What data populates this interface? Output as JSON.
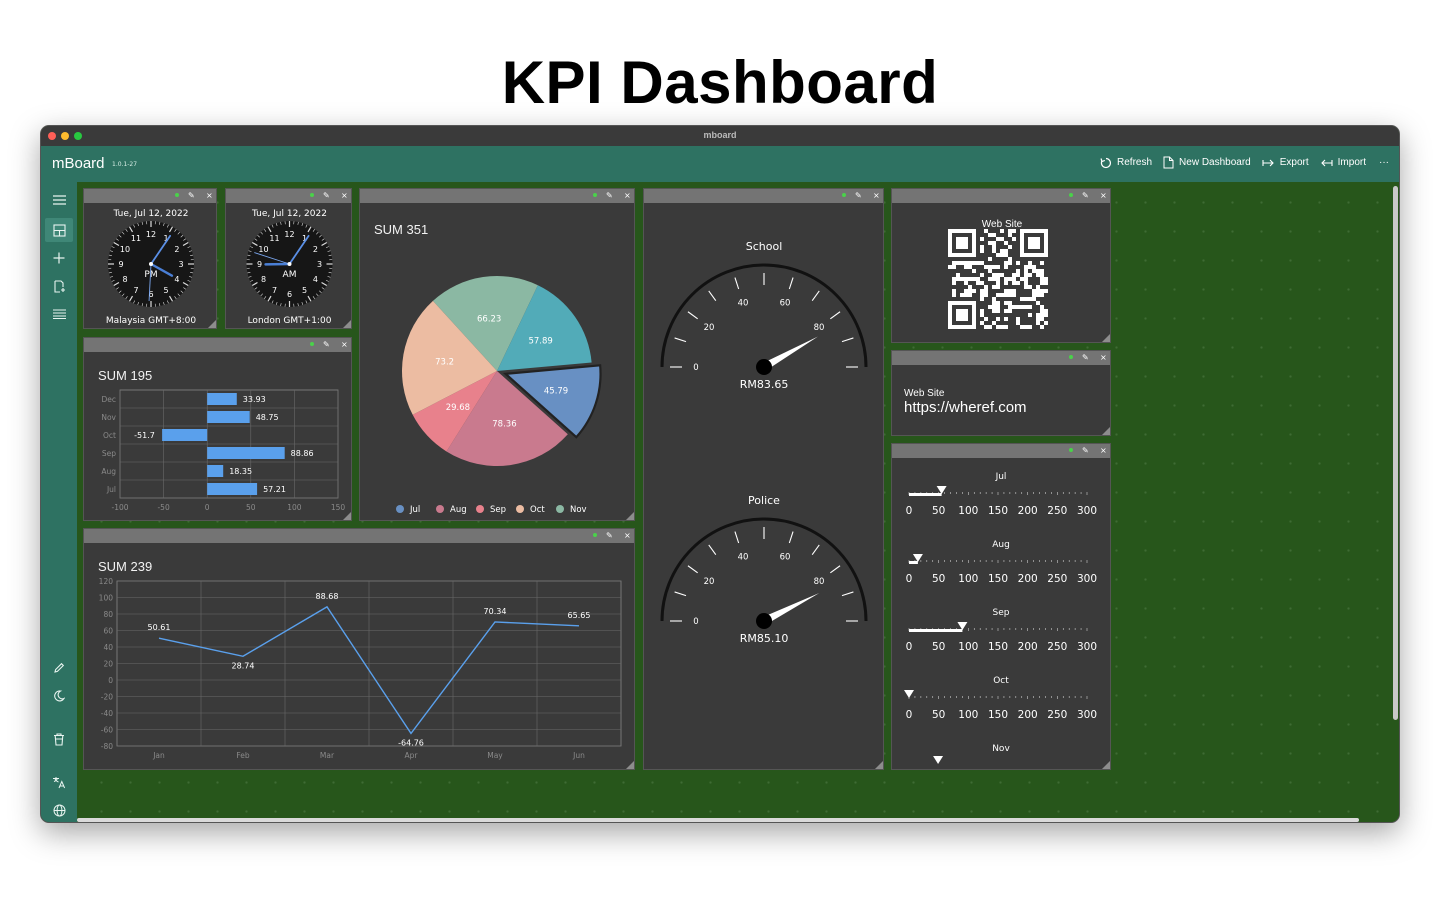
{
  "page": {
    "title": "KPI Dashboard"
  },
  "window": {
    "title": "mboard"
  },
  "app": {
    "brand": "mBoard",
    "version": "1.0.1-27"
  },
  "toolbar": {
    "refresh": "Refresh",
    "new_dashboard": "New Dashboard",
    "export": "Export",
    "import": "Import",
    "more": "···"
  },
  "icons": {
    "menu": "hamburger-icon",
    "dashboard": "dashboard-grid-icon",
    "add": "plus-icon",
    "add_datasource": "add-datasource-icon",
    "list": "list-icon",
    "edit": "pencil-icon",
    "theme": "moon-icon",
    "trash": "trash-icon",
    "translate": "translate-icon",
    "globe": "globe-icon",
    "widget_edit": "pin-icon",
    "widget_close": "close-icon"
  },
  "colors": {
    "accent": "#2e7262",
    "canvas": "#27561b",
    "widget_bg": "#3a3a3a",
    "widget_header": "#747474",
    "bar": "#5aa0ec",
    "line": "#5aa0ec"
  },
  "clocks": [
    {
      "date": "Tue, Jul 12, 2022",
      "ampm": "PM",
      "label": "Malaysia GMT+8:00",
      "hour": 15.97,
      "minute": 5.7,
      "second": 30.5
    },
    {
      "date": "Tue, Jul 12, 2022",
      "ampm": "AM",
      "label": "London GMT+1:00",
      "hour": 8.97,
      "minute": 5.7,
      "second": 48
    }
  ],
  "clock_numbers": [
    "12",
    "1",
    "2",
    "3",
    "4",
    "5",
    "6",
    "7",
    "8",
    "9",
    "10",
    "11"
  ],
  "widget_glyphs": {
    "edit": "✎",
    "close": "×"
  },
  "pie": {
    "sum": "SUM 351",
    "legend": [
      "Jul",
      "Aug",
      "Sep",
      "Oct",
      "Nov"
    ]
  },
  "bar": {
    "sum": "SUM 195"
  },
  "line": {
    "sum": "SUM 239"
  },
  "gauges": [
    {
      "title": "School",
      "value": 83.65,
      "readout": "RM83.65",
      "ticks": [
        "0",
        "20",
        "40",
        "60",
        "80"
      ]
    },
    {
      "title": "Police",
      "value": 85.1,
      "readout": "RM85.10",
      "ticks": [
        "0",
        "20",
        "40",
        "60",
        "80"
      ]
    }
  ],
  "qr": {
    "title": "Web Site"
  },
  "website": {
    "label": "Web Site",
    "url": "https://wheref.com"
  },
  "sliders": {
    "scale": [
      "0",
      "50",
      "100",
      "150",
      "200",
      "250",
      "300"
    ],
    "items": [
      {
        "label": "Jul",
        "value": 55.0
      },
      {
        "label": "Aug",
        "value": 15.0
      },
      {
        "label": "Sep",
        "value": 90.0
      },
      {
        "label": "Oct",
        "value": 0
      },
      {
        "label": "Nov",
        "value": 49.0
      }
    ]
  },
  "chart_data": [
    {
      "type": "pie",
      "title": "SUM 351",
      "categories": [
        "Jul",
        "Aug",
        "Sep",
        "Oct",
        "Nov"
      ],
      "slices": [
        {
          "label": "66.23",
          "value": 66.23,
          "color": "#8bb8a3"
        },
        {
          "label": "57.89",
          "value": 57.89,
          "color": "#52abb8"
        },
        {
          "label": "45.79",
          "value": 45.79,
          "color": "#6890c3",
          "exploded": true
        },
        {
          "label": "78.36",
          "value": 78.36,
          "color": "#c97a8e"
        },
        {
          "label": "29.68",
          "value": 29.68,
          "color": "#e8818c"
        },
        {
          "label": "73.2",
          "value": 73.2,
          "color": "#ecbca2"
        }
      ],
      "legend_colors": [
        "#6890c3",
        "#c97a8e",
        "#e8818c",
        "#ecbca2",
        "#8bb8a3"
      ],
      "legend_position": "bottom"
    },
    {
      "type": "bar",
      "orientation": "horizontal",
      "title": "SUM 195",
      "categories": [
        "Dec",
        "Nov",
        "Oct",
        "Sep",
        "Aug",
        "Jul"
      ],
      "values": [
        33.93,
        48.75,
        -51.7,
        88.86,
        18.35,
        57.21
      ],
      "xlim": [
        -100,
        150
      ],
      "xticks": [
        -100,
        -50,
        0,
        50,
        100,
        150
      ],
      "grid": true
    },
    {
      "type": "line",
      "title": "SUM 239",
      "categories": [
        "Jan",
        "Feb",
        "Mar",
        "Apr",
        "May",
        "Jun"
      ],
      "values": [
        50.61,
        28.74,
        88.68,
        -64.76,
        70.34,
        65.65
      ],
      "ylim": [
        -80,
        120
      ],
      "yticks": [
        -80,
        -60,
        -40,
        -20,
        0,
        20,
        40,
        60,
        80,
        100,
        120
      ],
      "grid": true
    }
  ]
}
